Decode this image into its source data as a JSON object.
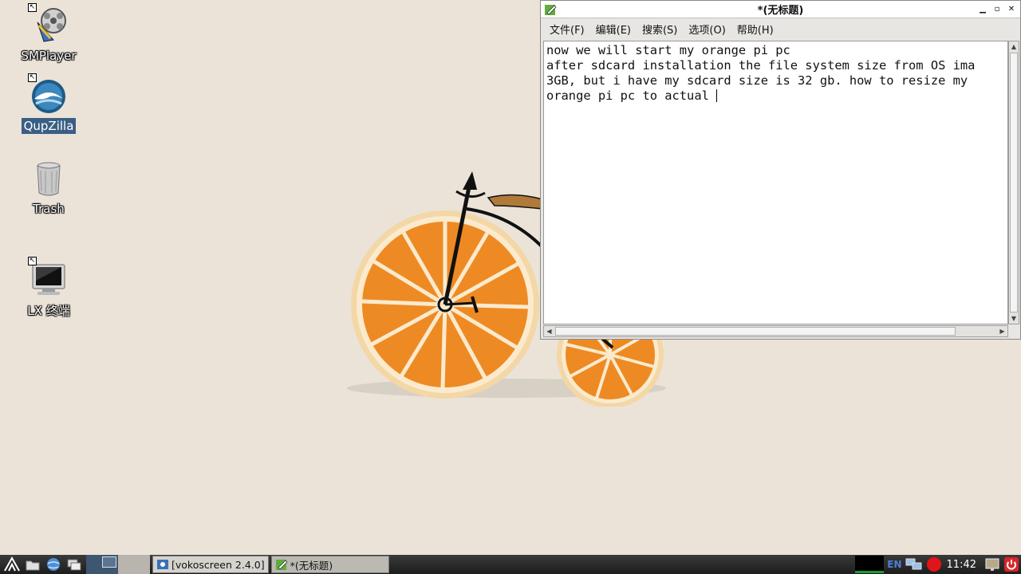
{
  "desktop": {
    "icons": [
      {
        "label": "SMPlayer"
      },
      {
        "label": "QupZilla"
      },
      {
        "label": "Trash"
      },
      {
        "label": "LX 终端"
      }
    ]
  },
  "editor": {
    "title": "*(无标题)",
    "menu": [
      "文件(F)",
      "编辑(E)",
      "搜索(S)",
      "选项(O)",
      "帮助(H)"
    ],
    "lines": [
      "now we will start my orange pi pc",
      "after sdcard installation the file system size from OS ima",
      "3GB, but i have my sdcard size is 32 gb. how to resize my",
      "orange pi pc to actual "
    ]
  },
  "taskbar": {
    "tasks": [
      {
        "label": "[vokoscreen 2.4.0]"
      },
      {
        "label": "*(无标题)"
      }
    ],
    "lang": "EN",
    "clock": "11:42"
  }
}
